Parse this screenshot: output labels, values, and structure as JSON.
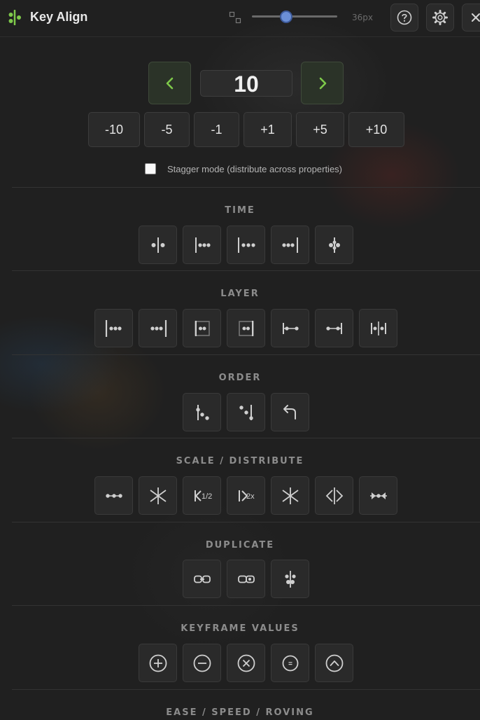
{
  "app": {
    "title": "Key Align",
    "accent_color": "#7ec94a",
    "size_slider": {
      "value_label": "36px",
      "level_percent": 40
    }
  },
  "toolbar": {
    "help_icon": "question-circle-icon",
    "settings_icon": "gear-icon",
    "close_icon": "close-icon"
  },
  "stepper": {
    "value": "10",
    "prev_icon": "chevron-left-icon",
    "next_icon": "chevron-right-icon",
    "increments": [
      "-10",
      "-5",
      "-1",
      "+1",
      "+5",
      "+10"
    ]
  },
  "stagger": {
    "label": "Stagger mode (distribute across properties)",
    "checked": false
  },
  "sections": [
    {
      "key": "time",
      "title": "TIME",
      "buttons": [
        "align-center-icon",
        "align-start-icon",
        "align-start-spread-icon",
        "align-end-icon",
        "align-cross-icon"
      ]
    },
    {
      "key": "layer",
      "title": "LAYER",
      "buttons": [
        "layer-in-point-icon",
        "layer-out-point-icon",
        "work-area-start-icon",
        "work-area-end-icon",
        "marker-start-icon",
        "marker-end-icon",
        "marker-split-icon"
      ]
    },
    {
      "key": "order",
      "title": "ORDER",
      "buttons": [
        "cascade-down-icon",
        "cascade-up-icon",
        "reverse-icon"
      ]
    },
    {
      "key": "scale",
      "title": "SCALE / DISTRIBUTE",
      "buttons": [
        "distribute-icon",
        "compress-icon",
        "scale-half-icon",
        "scale-double-icon",
        "collapse-icon",
        "expand-icon",
        "converge-icon"
      ]
    },
    {
      "key": "duplicate",
      "title": "DUPLICATE",
      "buttons": [
        "duplicate-link-icon",
        "duplicate-chain-icon",
        "duplicate-stack-icon"
      ]
    },
    {
      "key": "values",
      "title": "KEYFRAME VALUES",
      "buttons": [
        "add-value-icon",
        "subtract-value-icon",
        "multiply-value-icon",
        "equal-value-icon",
        "ease-value-icon"
      ]
    },
    {
      "key": "ease",
      "title": "EASE / SPEED / ROVING",
      "buttons": []
    }
  ]
}
